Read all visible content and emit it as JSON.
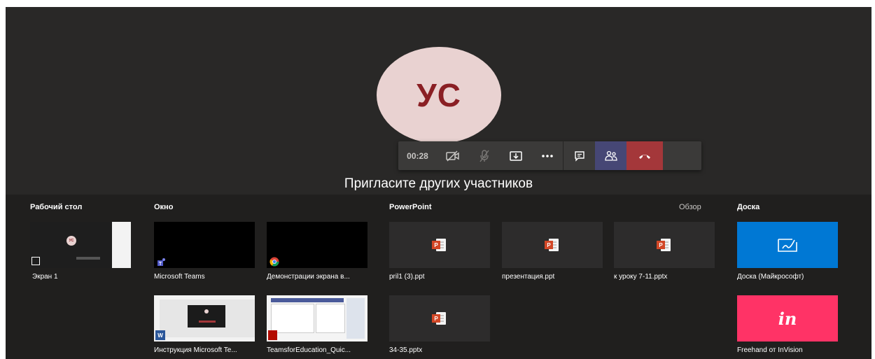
{
  "call": {
    "avatar_initials": "УС",
    "timer": "00:28",
    "invite_text": "Пригласите других участников"
  },
  "toolbar": {
    "buttons": [
      "camera-off",
      "mic-off",
      "share-tray",
      "more-options",
      "chat",
      "participants",
      "hang-up"
    ]
  },
  "share_tray": {
    "sections": {
      "desktop": "Рабочий стол",
      "window": "Окно",
      "powerpoint": "PowerPoint",
      "browse": "Обзор",
      "whiteboard": "Доска"
    },
    "desktop_items": [
      "Экран 1"
    ],
    "window_items": [
      "Microsoft Teams",
      "Демонстрации экрана в...",
      "Инструкция Microsoft Te...",
      "TeamsforEducation_Quic..."
    ],
    "ppt_items": [
      "pril1 (3).ppt",
      "презентация.ppt",
      "к уроку 7-11.pptx",
      "34-35.pptx"
    ],
    "ppt_badge": "P",
    "whiteboard_items": [
      "Доска (Майкрософт)",
      "Freehand от InVision"
    ],
    "invision_logo": "in",
    "desktop_thumb_initials": "УС",
    "word_badge": "W"
  },
  "colors": {
    "avatar_bg": "#e9d2d1",
    "avatar_text": "#8a1f24",
    "participants_active": "#464775",
    "hangup": "#a4373a",
    "whiteboard_blue": "#0078d4",
    "invision_pink": "#ff3366",
    "ppt_red": "#d24726"
  }
}
